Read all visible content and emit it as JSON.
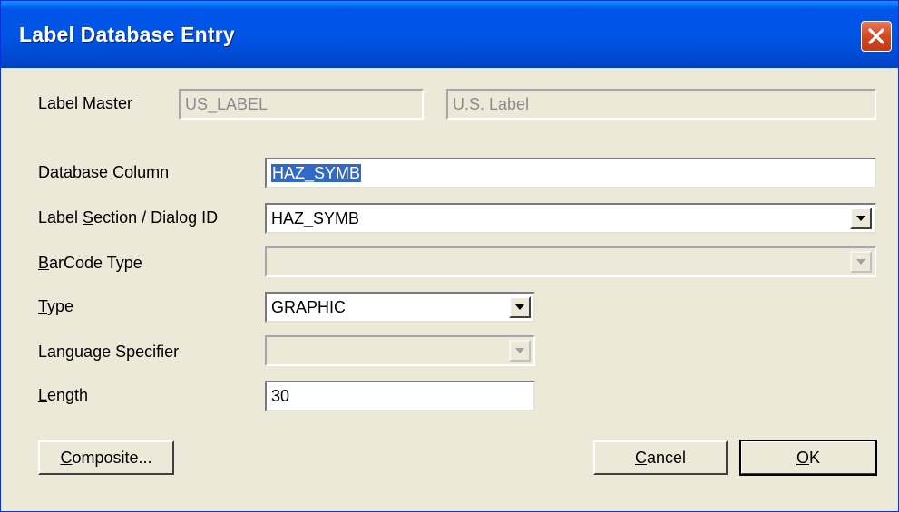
{
  "window": {
    "title": "Label Database Entry"
  },
  "label_master": {
    "label": "Label Master",
    "code": "US_LABEL",
    "name": "U.S. Label"
  },
  "database_column": {
    "label_pre": "Database ",
    "label_hotkey": "C",
    "label_post": "olumn",
    "value": "HAZ_SYMB"
  },
  "label_section": {
    "label_pre": "Label ",
    "label_hotkey": "S",
    "label_post": "ection / Dialog ID",
    "value": "HAZ_SYMB"
  },
  "barcode_type": {
    "label_pre": "",
    "label_hotkey": "B",
    "label_post": "arCode Type",
    "value": ""
  },
  "type": {
    "label_pre": "",
    "label_hotkey": "T",
    "label_post": "ype",
    "value": "GRAPHIC"
  },
  "language_specifier": {
    "label": "Language Specifier",
    "value": ""
  },
  "length": {
    "label_pre": "",
    "label_hotkey": "L",
    "label_post": "ength",
    "value": "30"
  },
  "buttons": {
    "composite": {
      "hotkey": "C",
      "rest": "omposite..."
    },
    "cancel": {
      "hotkey": "C",
      "rest": "ancel"
    },
    "ok": {
      "hotkey": "O",
      "rest": "K"
    }
  },
  "colors": {
    "titlebar": "#0055e5",
    "dialog_bg": "#ece9d8",
    "selection": "#316ac5",
    "close_button": "#d4481f"
  }
}
